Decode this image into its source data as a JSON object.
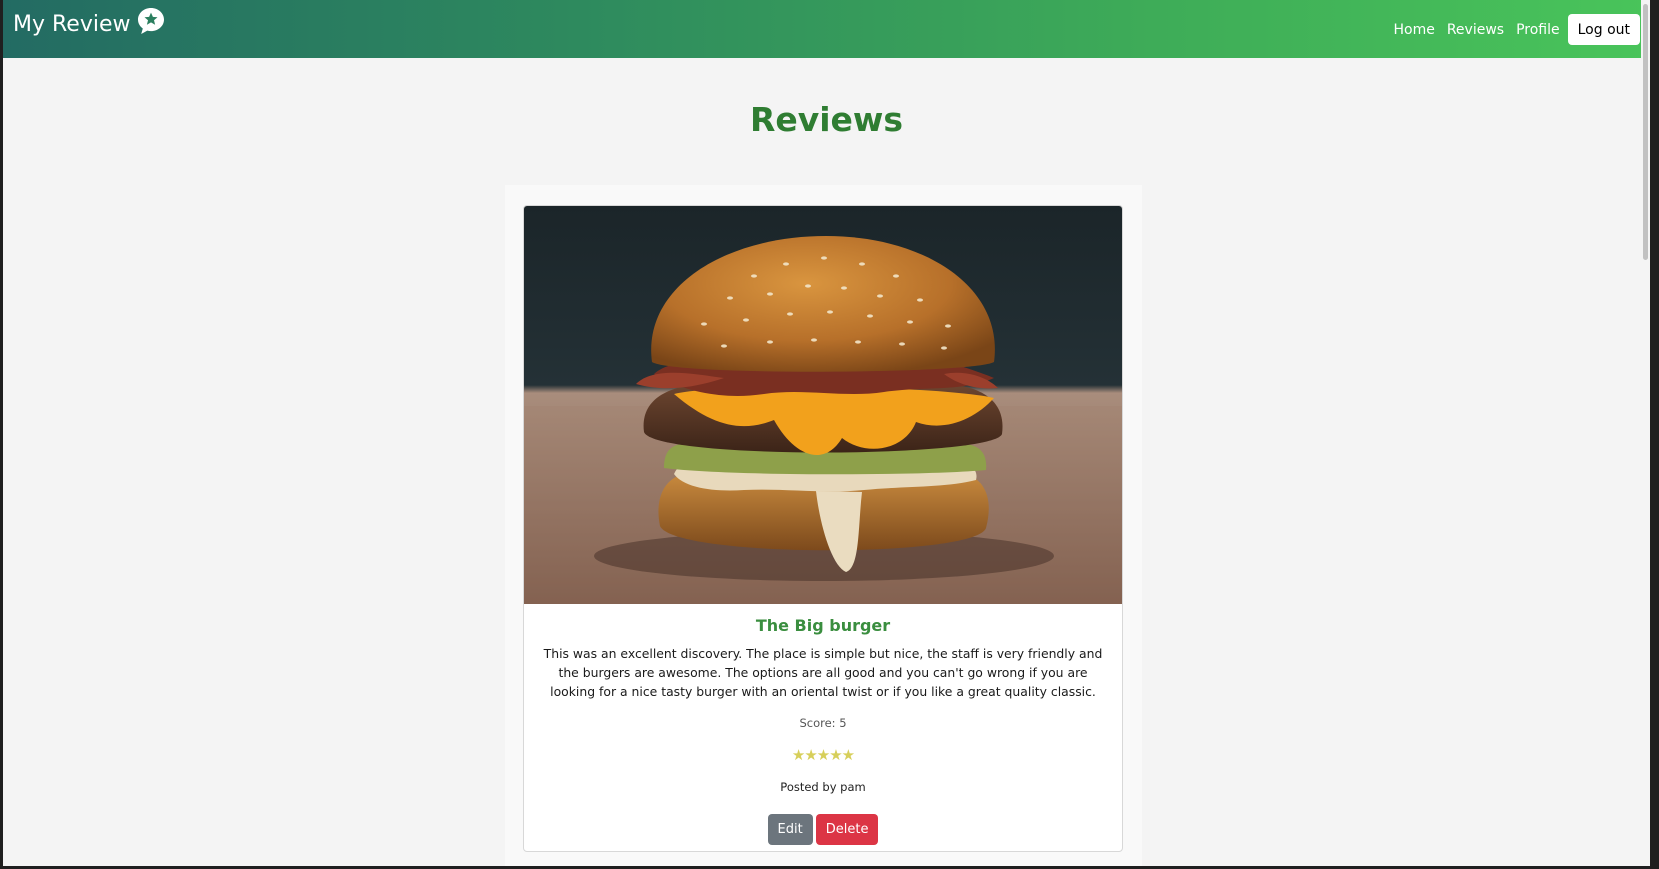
{
  "navbar": {
    "brand": "My Review",
    "brand_icon": "star-speech-bubble-icon",
    "links": [
      "Home",
      "Reviews",
      "Profile"
    ],
    "logout_label": "Log out",
    "gradient_start": "#236b63",
    "gradient_end": "#49c45a"
  },
  "page": {
    "title": "Reviews"
  },
  "review": {
    "image_subject": "burger-photo",
    "title": "The Big burger",
    "text": "This was an excellent discovery. The place is simple but nice, the staff is very friendly and the burgers are awesome. The options are all good and you can't go wrong if you are looking for a nice tasty burger with an oriental twist or if you like a great quality classic.",
    "score_label": "Score: 5",
    "rating": 5,
    "rating_max": 5,
    "stars_text": "★★★★★",
    "posted_by": "Posted by pam",
    "edit_label": "Edit",
    "delete_label": "Delete"
  },
  "colors": {
    "title_green": "#2f7d32",
    "card_title_green": "#3a8e3f",
    "star_yellow": "#d7cf5a",
    "edit_gray": "#6c757d",
    "delete_red": "#dc3545"
  }
}
